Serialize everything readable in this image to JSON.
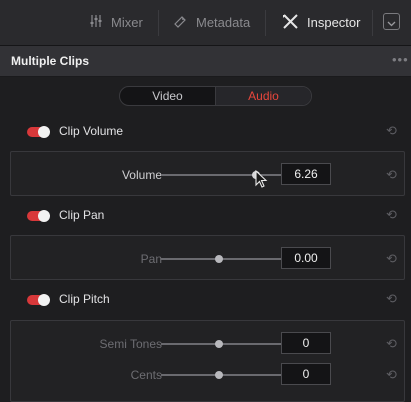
{
  "tabs": [
    {
      "label": "Mixer",
      "icon": "mixer-icon",
      "active": false
    },
    {
      "label": "Metadata",
      "icon": "metadata-icon",
      "active": false
    },
    {
      "label": "Inspector",
      "icon": "inspector-icon",
      "active": true
    }
  ],
  "panel": {
    "title": "Multiple Clips"
  },
  "segment": {
    "options": [
      "Video",
      "Audio"
    ],
    "selected": "Audio"
  },
  "colors": {
    "accent": "#e8463c",
    "toggle_on": "#d8383a"
  },
  "sections": [
    {
      "label": "Clip Volume",
      "enabled": true,
      "params": [
        {
          "label": "Volume",
          "value": "6.26",
          "slider": 0.8,
          "dim": false
        }
      ]
    },
    {
      "label": "Clip Pan",
      "enabled": true,
      "params": [
        {
          "label": "Pan",
          "value": "0.00",
          "slider": 0.48,
          "dim": true
        }
      ]
    },
    {
      "label": "Clip Pitch",
      "enabled": true,
      "params": [
        {
          "label": "Semi Tones",
          "value": "0",
          "slider": 0.48,
          "dim": true
        },
        {
          "label": "Cents",
          "value": "0",
          "slider": 0.48,
          "dim": true
        }
      ]
    }
  ]
}
